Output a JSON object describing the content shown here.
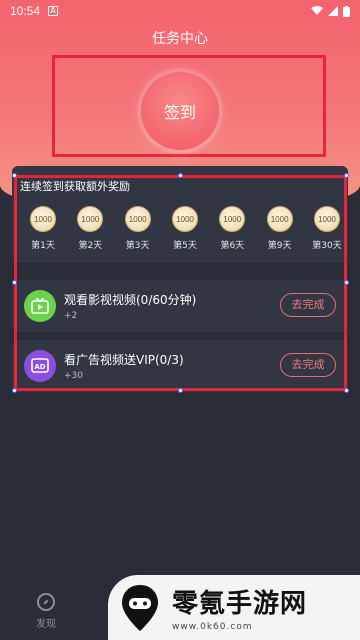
{
  "status": {
    "time": "10:54"
  },
  "header": {
    "title": "任务中心",
    "checkin_label": "签到"
  },
  "reward": {
    "title": "连续签到获取额外奖励",
    "items": [
      {
        "coin": "1000",
        "day": "第1天"
      },
      {
        "coin": "1000",
        "day": "第2天"
      },
      {
        "coin": "1000",
        "day": "第3天"
      },
      {
        "coin": "1000",
        "day": "第5天"
      },
      {
        "coin": "1000",
        "day": "第6天"
      },
      {
        "coin": "1000",
        "day": "第9天"
      },
      {
        "coin": "1000",
        "day": "第30天"
      }
    ]
  },
  "tasks": [
    {
      "name": "观看影视视频(0/60分钟)",
      "reward": "+2",
      "button": "去完成",
      "icon": "tv-icon",
      "color": "#6cd24b"
    },
    {
      "name": "看广告视频送VIP(0/3)",
      "reward": "+30",
      "button": "去完成",
      "icon": "ad-icon",
      "color": "#8a4fe0"
    }
  ],
  "nav": {
    "discover_label": "发现"
  },
  "watermark": {
    "brand": "零氪手游网",
    "url": "www.0k60.com"
  },
  "colors": {
    "accent": "#f3636e",
    "annotation": "#e8243a"
  }
}
